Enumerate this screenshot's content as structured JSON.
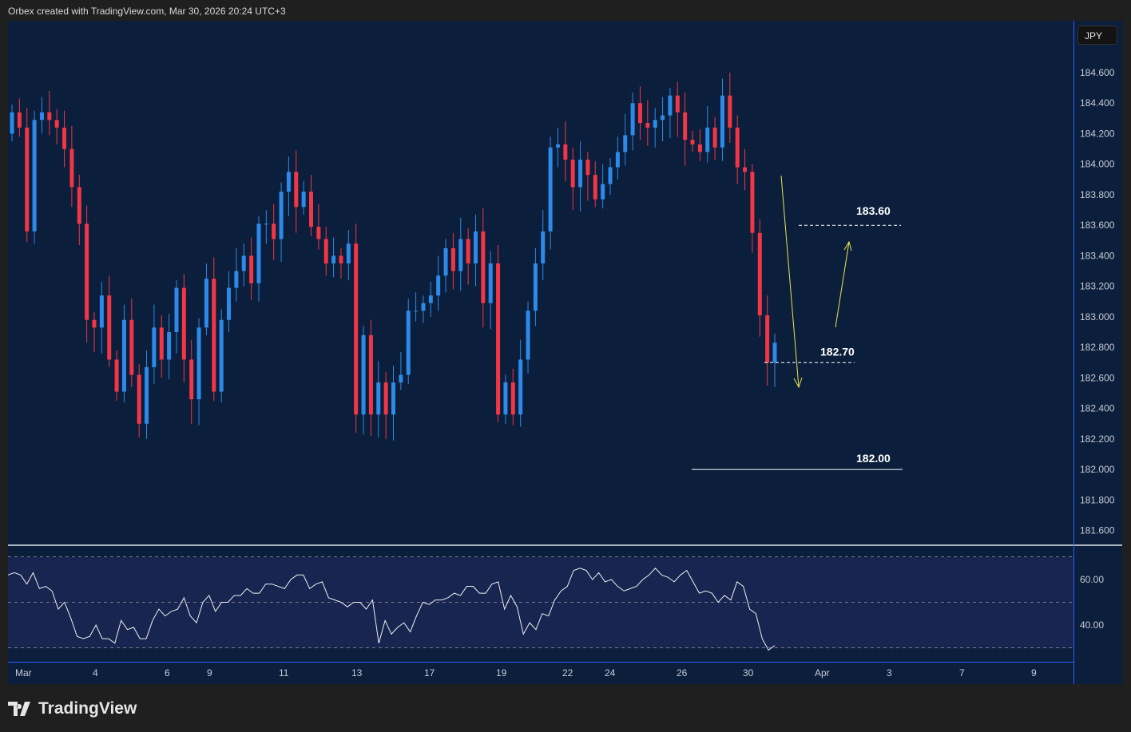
{
  "header": {
    "credit": "Orbex created with TradingView.com, Mar 30, 2026 20:24 UTC+3"
  },
  "currency_button": "JPY",
  "logo_text": "TradingView",
  "colors": {
    "up": "#2d8ae8",
    "down": "#f23645",
    "bg": "#0b1e3c",
    "rsi_bg": "#172550",
    "annot": "#e8e84a"
  },
  "chart_data": [
    {
      "type": "candlestick",
      "title": "",
      "ylabel": "JPY",
      "ylim": [
        181.5,
        184.75
      ],
      "yticks": [
        "184.600",
        "184.400",
        "184.200",
        "184.000",
        "183.800",
        "183.600",
        "183.400",
        "183.200",
        "183.000",
        "182.800",
        "182.600",
        "182.400",
        "182.200",
        "182.000",
        "181.800",
        "181.600"
      ],
      "xticks": [
        "Mar",
        "4",
        "6",
        "9",
        "11",
        "13",
        "17",
        "19",
        "22",
        "24",
        "26",
        "30",
        "Apr",
        "3",
        "7",
        "9"
      ],
      "open_first": 184.2,
      "closes": [
        184.34,
        184.24,
        183.56,
        184.29,
        184.34,
        184.29,
        184.24,
        184.1,
        183.85,
        183.61,
        182.98,
        182.93,
        183.14,
        182.72,
        182.51,
        182.98,
        182.62,
        182.3,
        182.67,
        182.93,
        182.72,
        182.9,
        183.19,
        182.72,
        182.46,
        182.93,
        183.25,
        182.51,
        182.98,
        183.19,
        183.3,
        183.4,
        183.22,
        183.61,
        183.61,
        183.51,
        183.82,
        183.95,
        183.72,
        183.82,
        183.59,
        183.51,
        183.35,
        183.4,
        183.35,
        183.48,
        182.36,
        182.88,
        182.36,
        182.57,
        182.36,
        182.57,
        182.62,
        183.04,
        183.04,
        183.09,
        183.14,
        183.27,
        183.45,
        183.3,
        183.51,
        183.35,
        183.56,
        183.09,
        183.35,
        182.36,
        182.57,
        182.36,
        182.72,
        183.04,
        183.35,
        183.56,
        184.11,
        184.13,
        184.03,
        183.85,
        184.03,
        183.93,
        183.77,
        183.87,
        183.98,
        184.08,
        184.19,
        184.4,
        184.27,
        184.24,
        184.29,
        184.32,
        184.45,
        184.34,
        184.16,
        184.13,
        184.08,
        184.24,
        184.11,
        184.45,
        184.24,
        183.98,
        183.95,
        183.55,
        183.01,
        182.7,
        182.83
      ],
      "annotations": [
        {
          "type": "dashed-level",
          "value": 183.6,
          "label": "183.60"
        },
        {
          "type": "dashed-level",
          "value": 182.7,
          "label": "182.70"
        },
        {
          "type": "solid-level",
          "value": 182.0,
          "label": "182.00"
        },
        {
          "type": "arrow",
          "direction": "down",
          "from": 184.0,
          "to": 182.6
        },
        {
          "type": "arrow",
          "direction": "up",
          "from": 183.0,
          "to": 183.5
        }
      ]
    },
    {
      "type": "line",
      "name": "RSI",
      "ylim": [
        25,
        75
      ],
      "levels": [
        70,
        50,
        30
      ],
      "yticks": [
        "60.00",
        "40.00"
      ],
      "values": [
        62,
        63,
        62,
        58,
        63,
        56,
        57,
        55,
        47,
        50,
        43,
        35,
        34,
        35,
        40,
        34,
        34,
        32,
        42,
        38,
        39,
        34,
        34,
        42,
        47,
        44,
        46,
        47,
        52,
        44,
        41,
        50,
        53,
        46,
        50,
        50,
        53,
        53,
        56,
        54,
        54,
        58,
        58,
        57,
        56,
        60,
        62,
        62,
        56,
        58,
        59,
        52,
        51,
        50,
        48,
        50,
        50,
        47,
        51,
        32,
        42,
        36,
        39,
        41,
        37,
        44,
        50,
        49,
        51,
        51,
        52,
        54,
        53,
        57,
        57,
        54,
        54,
        58,
        59,
        47,
        53,
        48,
        36,
        41,
        38,
        45,
        44,
        51,
        55,
        57,
        64,
        65,
        64,
        60,
        63,
        59,
        60,
        57,
        55,
        56,
        57,
        60,
        62,
        65,
        62,
        61,
        59,
        62,
        64,
        59,
        54,
        55,
        54,
        50,
        53,
        51,
        59,
        57,
        47,
        45,
        34,
        29,
        31
      ]
    }
  ]
}
